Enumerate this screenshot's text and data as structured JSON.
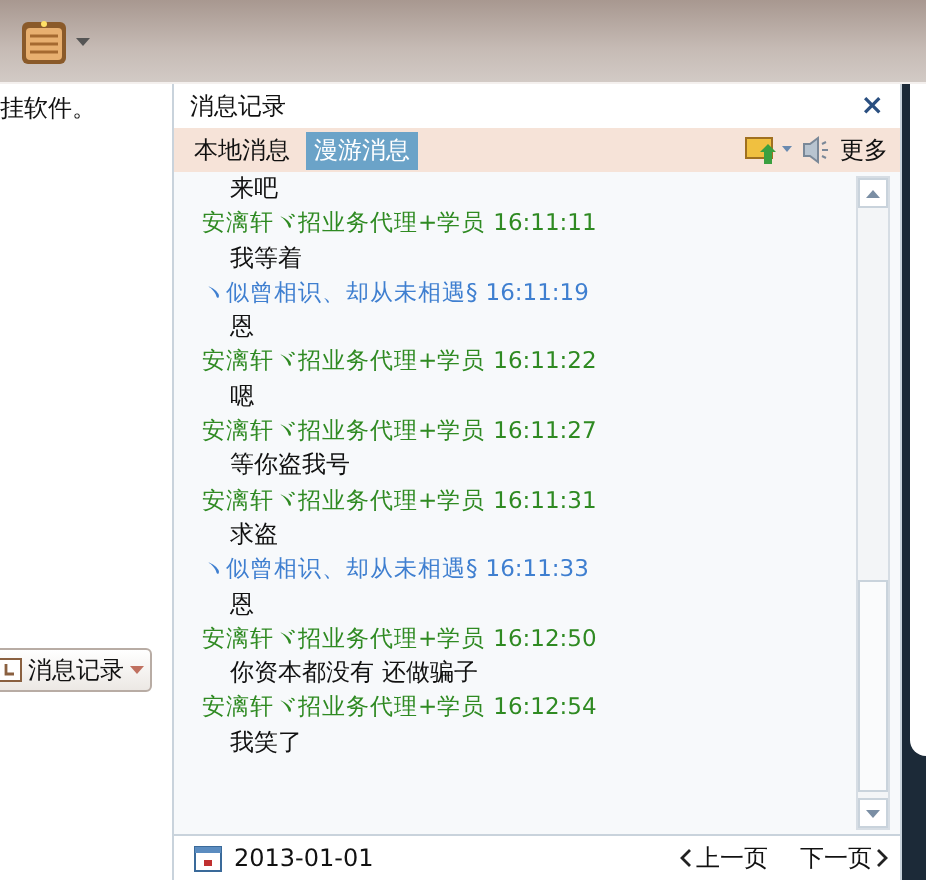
{
  "left_pane": {
    "notice": "挂软件。",
    "history_button": "消息记录"
  },
  "panel": {
    "title": "消息记录",
    "close": "×",
    "tabs": [
      {
        "label": "本地消息",
        "selected": false
      },
      {
        "label": "漫游消息",
        "selected": true
      }
    ],
    "more": "更多",
    "messages": [
      {
        "kind": "body",
        "text": "来吧"
      },
      {
        "kind": "header",
        "sender": "安漓轩ヾ招业务代理+学员",
        "time": "16:11:11",
        "color": "#2f8a22"
      },
      {
        "kind": "body",
        "text": "我等着"
      },
      {
        "kind": "header",
        "sender": "ヽ似曾相识、却从未相遇§",
        "time": "16:11:19",
        "color": "#3f7fd0"
      },
      {
        "kind": "body",
        "text": "恩"
      },
      {
        "kind": "header",
        "sender": "安漓轩ヾ招业务代理+学员",
        "time": "16:11:22",
        "color": "#2f8a22"
      },
      {
        "kind": "body",
        "text": "嗯"
      },
      {
        "kind": "header",
        "sender": "安漓轩ヾ招业务代理+学员",
        "time": "16:11:27",
        "color": "#2f8a22"
      },
      {
        "kind": "body",
        "text": "等你盗我号"
      },
      {
        "kind": "header",
        "sender": "安漓轩ヾ招业务代理+学员",
        "time": "16:11:31",
        "color": "#2f8a22"
      },
      {
        "kind": "body",
        "text": "求盗"
      },
      {
        "kind": "header",
        "sender": "ヽ似曾相识、却从未相遇§",
        "time": "16:11:33",
        "color": "#3f7fd0"
      },
      {
        "kind": "body",
        "text": "恩"
      },
      {
        "kind": "header",
        "sender": "安漓轩ヾ招业务代理+学员",
        "time": "16:12:50",
        "color": "#2f8a22"
      },
      {
        "kind": "body",
        "text": "你资本都没有 还做骗子"
      },
      {
        "kind": "header",
        "sender": "安漓轩ヾ招业务代理+学员",
        "time": "16:12:54",
        "color": "#2f8a22"
      },
      {
        "kind": "body",
        "text": "我笑了"
      }
    ],
    "footer": {
      "date": "2013-01-01",
      "prev": "上一页",
      "next": "下一页"
    }
  }
}
